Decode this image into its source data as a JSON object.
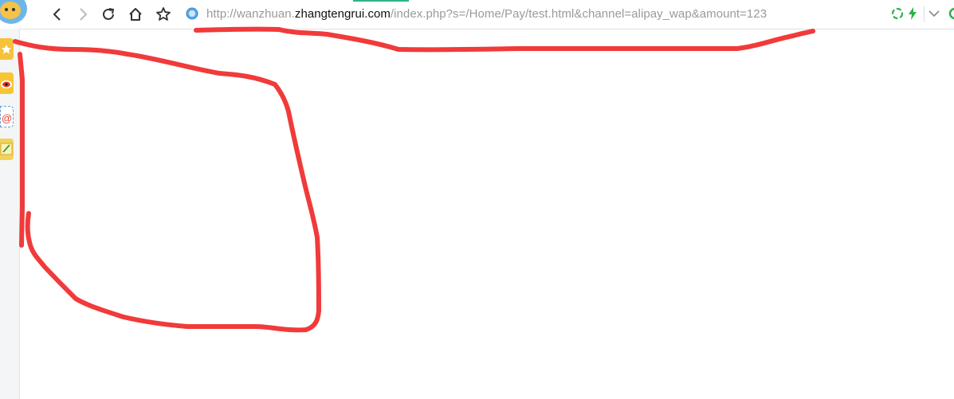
{
  "browser": {
    "address_bar": {
      "scheme_subdomain": "http://wanzhuan.",
      "host": "zhangtengrui.com",
      "path": "/index.php?s=/Home/Pay/test.html&channel=alipay_wap&amount=123"
    },
    "toolbar_buttons": [
      "back-icon",
      "forward-icon",
      "reload-icon",
      "home-icon",
      "bookmark-star-icon"
    ],
    "right_icons": [
      "recycle-icon",
      "lightning-icon",
      "dropdown-chevron-icon"
    ]
  },
  "sidebar": {
    "items": [
      "favorites-star-icon",
      "weibo-icon",
      "mail-icon",
      "notes-icon"
    ]
  },
  "colors": {
    "annotation": "#f13a3a",
    "url_host": "#111111",
    "url_rest": "#9a9a9a",
    "accent": "#2bb48a"
  }
}
